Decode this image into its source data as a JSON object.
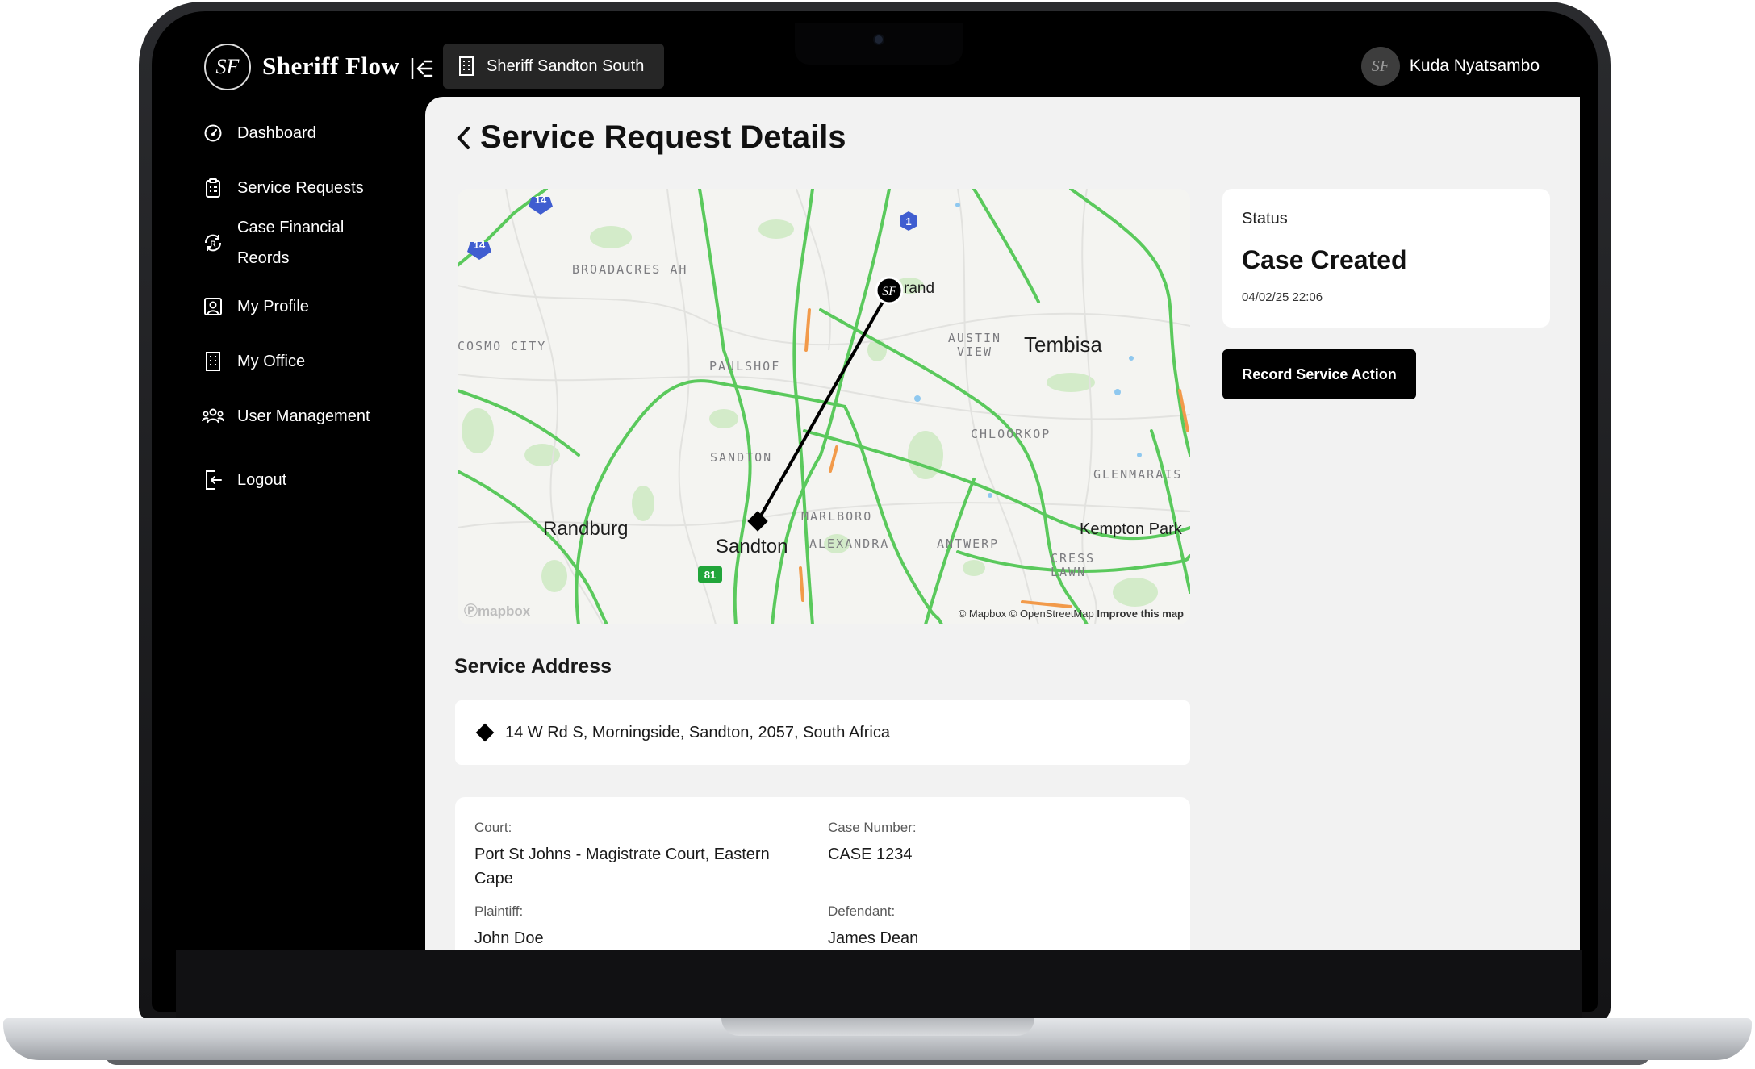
{
  "app": {
    "brand": "Sheriff Flow",
    "logo_text": "SF",
    "office": "Sheriff Sandton South",
    "user_name": "Kuda Nyatsambo"
  },
  "sidebar": {
    "items": [
      {
        "label": "Dashboard",
        "icon": "dashboard-icon"
      },
      {
        "label": "Service Requests",
        "icon": "clipboard-icon"
      },
      {
        "label": "Case Financial Reords",
        "icon": "currency-cycle-icon"
      },
      {
        "label": "My Profile",
        "icon": "profile-icon"
      },
      {
        "label": "My Office",
        "icon": "building-icon"
      },
      {
        "label": "User Management",
        "icon": "users-icon"
      },
      {
        "label": "Logout",
        "icon": "logout-icon"
      }
    ]
  },
  "page": {
    "title": "Service Request Details"
  },
  "map": {
    "places": [
      "BROADACRES AH",
      "COSMO CITY",
      "PAULSHOF",
      "AUSTIN VIEW",
      "SANDTON",
      "CHLOORKOP",
      "GLENMARAIS",
      "MARLBORO",
      "ALEXANDRA",
      "ANTWERP",
      "CRESS LAWN"
    ],
    "cities": [
      "Randburg",
      "Sandton",
      "Tembisa",
      "Kempton Park",
      "rand"
    ],
    "route_shields": [
      "14",
      "14",
      "1",
      "81"
    ],
    "attribution": "© Mapbox © OpenStreetMap",
    "improve_link": "Improve this map",
    "provider_logo": "mapbox"
  },
  "status": {
    "label": "Status",
    "value": "Case Created",
    "date": "04/02/25 22:06"
  },
  "record_action_label": "Record Service Action",
  "service_address": {
    "title": "Service Address",
    "address": "14 W Rd S, Morningside, Sandton, 2057, South Africa"
  },
  "details": {
    "court_label": "Court:",
    "court": "Port St Johns - Magistrate Court, Eastern Cape",
    "case_number_label": "Case Number:",
    "case_number": "CASE 1234",
    "plaintiff_label": "Plaintiff:",
    "plaintiff": "John Doe",
    "defendant_label": "Defendant:",
    "defendant": "James Dean"
  },
  "colors": {
    "accent": "#000000",
    "road_green": "#4ccb55",
    "road_orange": "#f29a4a",
    "park_green": "#cfe9c4"
  }
}
